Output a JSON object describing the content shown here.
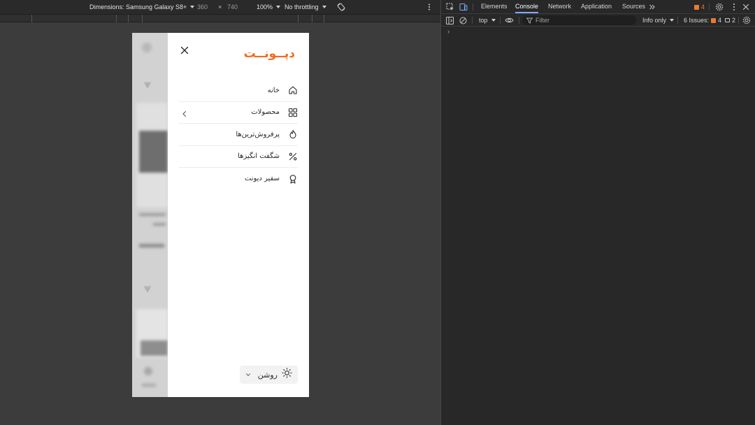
{
  "device_toolbar": {
    "dimensions_label": "Dimensions: Samsung Galaxy S8+",
    "width": "360",
    "times": "×",
    "height": "740",
    "zoom": "100%",
    "throttling": "No throttling"
  },
  "drawer": {
    "logo": "دپــونــت",
    "menu": [
      {
        "label": "خانه",
        "icon": "home-icon",
        "has_chevron": false
      },
      {
        "label": "محصولات",
        "icon": "grid-icon",
        "has_chevron": true
      },
      {
        "label": "پرفروش‌ترین‌ها",
        "icon": "flame-icon",
        "has_chevron": false
      },
      {
        "label": "شگفت انگیزها",
        "icon": "percent-icon",
        "has_chevron": false
      },
      {
        "label": "سفیر دیونت",
        "icon": "badge-icon",
        "has_chevron": false
      }
    ],
    "theme": {
      "label": "روشن",
      "icon": "sun-icon"
    }
  },
  "devtools": {
    "tabs": [
      "Elements",
      "Console",
      "Network",
      "Application",
      "Sources"
    ],
    "active_tab": "Console",
    "issues_badge_count": "4",
    "console": {
      "context": "top",
      "filter_placeholder": "Filter",
      "level": "Info only",
      "issues_label": "6 Issues:",
      "issues_warnings": "4",
      "issues_info": "2"
    },
    "prompt": "›"
  },
  "colors": {
    "accent": "#f26b1d",
    "devtools_bg": "#282828",
    "viewport_bg": "#3c3c3c"
  }
}
